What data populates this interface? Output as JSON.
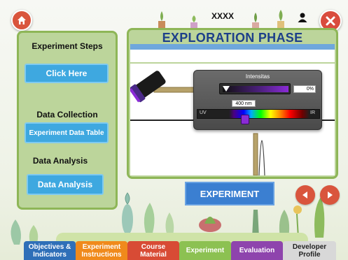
{
  "header": {
    "user_name": "XXXX"
  },
  "left_panel": {
    "steps_heading": "Experiment Steps",
    "steps_button": "Click Here",
    "data_collection_heading": "Data Collection",
    "data_table_button": "Experiment Data Table",
    "data_analysis_heading": "Data Analysis",
    "data_analysis_button": "Data Analysis"
  },
  "phase": {
    "title": "EXPLORATION PHASE"
  },
  "controls": {
    "intensity_label": "Intensitas",
    "intensity_value": "0%",
    "wavelength_value": "400 nm",
    "spectrum_left_label": "UV",
    "spectrum_right_label": "IR"
  },
  "main": {
    "experiment_button": "EXPERIMENT"
  },
  "tabs": [
    {
      "label": "Objectives & Indicators",
      "color": "#2f6fb8"
    },
    {
      "label": "Experiment Instructions",
      "color": "#f08a1c"
    },
    {
      "label": "Course Material",
      "color": "#d84b35"
    },
    {
      "label": "Experiment",
      "color": "#8cc152"
    },
    {
      "label": "Evaluation",
      "color": "#8e44ad"
    },
    {
      "label": "Developer Profile",
      "color": "#d8d8d8"
    }
  ],
  "colors": {
    "accent_red": "#d9553d",
    "panel_green": "#bcd59b",
    "button_blue": "#3ea8e0",
    "title_blue": "#1d3f8a"
  },
  "icons": {
    "home": "home-icon",
    "close": "close-icon",
    "user": "user-icon",
    "prev": "chevron-left-icon",
    "next": "chevron-right-icon"
  }
}
